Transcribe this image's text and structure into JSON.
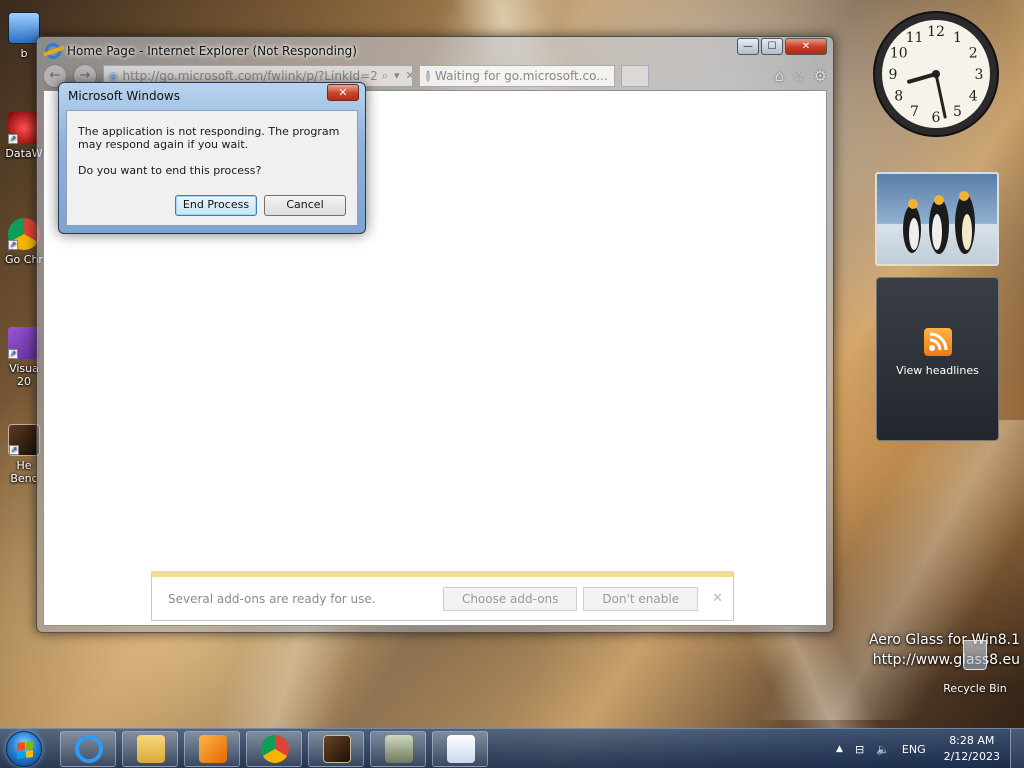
{
  "desktop": {
    "icons": [
      {
        "label": "b",
        "icon": "computer-icon"
      },
      {
        "label": "DataW",
        "icon": "datawarrior-icon"
      },
      {
        "label": "Go Chr",
        "icon": "chrome-icon"
      },
      {
        "label": "Visua 20",
        "icon": "visual-studio-icon"
      },
      {
        "label": "He Benc",
        "icon": "heaven-benchmark-icon"
      }
    ],
    "watermark_line1": "Aero Glass for Win8.1",
    "watermark_line2": "http://www.glass8.eu",
    "recycle_bin_label": "Recycle Bin"
  },
  "ie_window": {
    "title": "Home Page - Internet Explorer (Not Responding)",
    "address": "http://go.microsoft.com/fwlink/p/?LinkId=2",
    "tab_title": "Waiting for go.microsoft.co...",
    "tab_close": "✕",
    "buttons": {
      "minimize": "—",
      "maximize": "☐",
      "close": "✕"
    },
    "notification": {
      "text": "Several add-ons are ready for use.",
      "choose_label": "Choose add-ons",
      "dont_enable_label": "Don't enable",
      "close": "✕"
    }
  },
  "dialog": {
    "title": "Microsoft Windows",
    "close": "✕",
    "message": "The application is not responding. The program may respond again if you wait.",
    "question": "Do you want to end this process?",
    "end_process_label": "End Process",
    "cancel_label": "Cancel"
  },
  "gadgets": {
    "clock": {
      "hour": 8,
      "minute": 28,
      "numbers": [
        "12",
        "1",
        "2",
        "3",
        "4",
        "5",
        "6",
        "7",
        "8",
        "9",
        "10",
        "11"
      ]
    },
    "feed_label": "View headlines"
  },
  "taskbar": {
    "apps": [
      "internet-explorer",
      "file-explorer",
      "media-player",
      "chrome",
      "heaven-benchmark",
      "monitor-app",
      "text-editor"
    ],
    "language": "ENG",
    "time": "8:28 AM",
    "date": "2/12/2023",
    "tray_arrow": "▲"
  },
  "colors": {
    "accent": "#2a7fd4",
    "close_red": "#c8402a",
    "notif_bar": "#f3dd94"
  }
}
